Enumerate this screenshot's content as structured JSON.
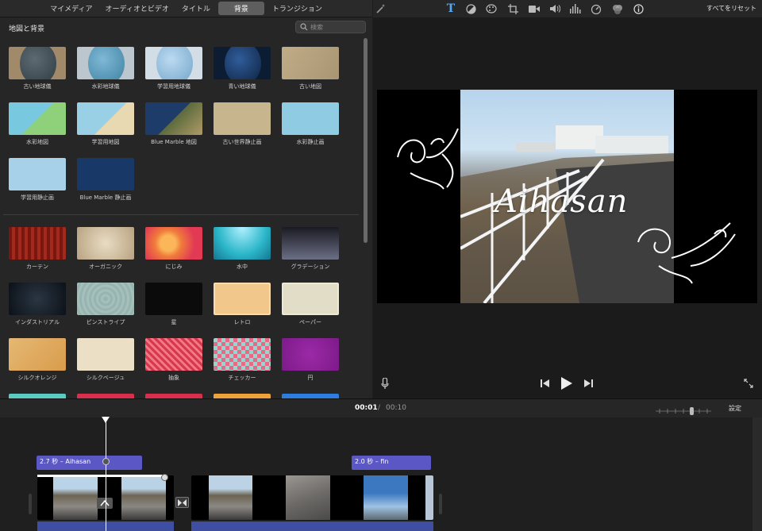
{
  "tabs": [
    {
      "label": "マイメディア"
    },
    {
      "label": "オーディオとビデオ"
    },
    {
      "label": "タイトル"
    },
    {
      "label": "背景"
    },
    {
      "label": "トランジション"
    }
  ],
  "active_tab": "背景",
  "browser": {
    "section_title": "地図と背景",
    "search_placeholder": "検索",
    "maps": [
      {
        "label": "古い地球儀",
        "style": "globe-old"
      },
      {
        "label": "水彩地球儀",
        "style": "globe-water"
      },
      {
        "label": "学習用地球儀",
        "style": "globe-school"
      },
      {
        "label": "青い地球儀",
        "style": "globe-blue"
      },
      {
        "label": "古い地図",
        "style": "old-map"
      },
      {
        "label": "水彩地図",
        "style": "water-map"
      },
      {
        "label": "学習用地図",
        "style": "school-map"
      },
      {
        "label": "Blue Marble 地図",
        "style": "bm-map"
      },
      {
        "label": "古い世界静止画",
        "style": "old-world"
      },
      {
        "label": "水彩静止画",
        "style": "water-world"
      },
      {
        "label": "学習用静止画",
        "style": "school-world"
      },
      {
        "label": "Blue Marble 静止画",
        "style": "bm-world"
      }
    ],
    "backgrounds": [
      {
        "label": "カーテン",
        "style": "curtain"
      },
      {
        "label": "オーガニック",
        "style": "organic"
      },
      {
        "label": "にじみ",
        "style": "nijimi"
      },
      {
        "label": "水中",
        "style": "suichu"
      },
      {
        "label": "グラデーション",
        "style": "gradation"
      },
      {
        "label": "インダストリアル",
        "style": "industrial"
      },
      {
        "label": "ピンストライプ",
        "style": "pinstripe"
      },
      {
        "label": "星",
        "style": "star"
      },
      {
        "label": "レトロ",
        "style": "retro"
      },
      {
        "label": "ペーパー",
        "style": "paper"
      },
      {
        "label": "シルクオレンジ",
        "style": "silk-orange"
      },
      {
        "label": "シルクベージュ",
        "style": "silk-beige"
      },
      {
        "label": "抽象",
        "style": "abstract"
      },
      {
        "label": "チェッカー",
        "style": "checker"
      },
      {
        "label": "円",
        "style": "circle-bg"
      }
    ]
  },
  "viewer": {
    "reset_all": "すべてをリセット",
    "tools": [
      "magic-wand-icon",
      "title-tool-icon",
      "color-balance-icon",
      "color-correction-icon",
      "crop-icon",
      "stabilization-icon",
      "volume-icon",
      "equalizer-icon",
      "speed-icon",
      "filter-icon",
      "info-icon"
    ],
    "title_text": "Aihasan"
  },
  "timeline": {
    "current_time": "00:01",
    "separator": "/",
    "total_time": "00:10",
    "settings_label": "設定",
    "title_clips": [
      {
        "label": "2.7 秒 – Aihasan"
      },
      {
        "label": "2.0 秒 – fin"
      }
    ]
  },
  "colors": {
    "accent": "#5b57c5",
    "audio": "#3e4fa3",
    "panel": "#262626"
  }
}
